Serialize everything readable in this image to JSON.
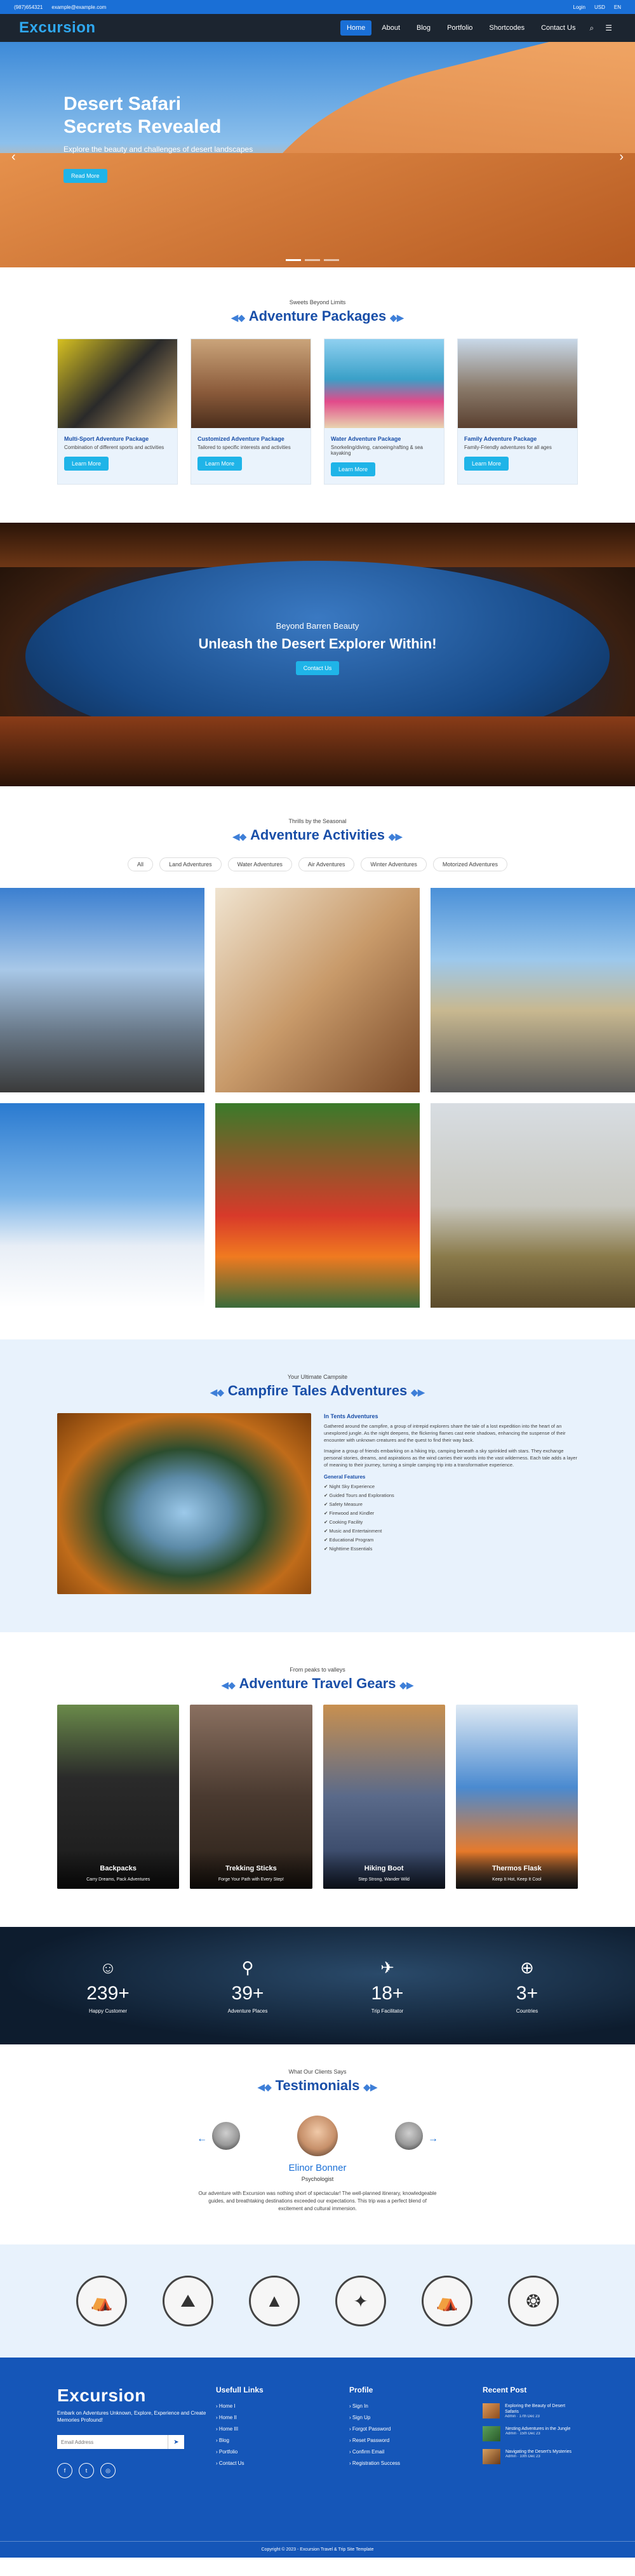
{
  "topbar": {
    "phone": "(987)654321",
    "email": "example@example.com",
    "login": "Login",
    "currency": "USD",
    "language": "EN"
  },
  "nav": {
    "logo": "Excursion",
    "items": [
      "Home",
      "About",
      "Blog",
      "Portfolio",
      "Shortcodes",
      "Contact Us"
    ],
    "active": "Home"
  },
  "hero": {
    "title": "Desert Safari Secrets Revealed",
    "subtitle": "Explore the beauty and challenges of desert landscapes",
    "button": "Read More"
  },
  "packages": {
    "subtitle": "Sweets Beyond Limits",
    "title": "Adventure Packages",
    "items": [
      {
        "title": "Multi-Sport Adventure Package",
        "desc": "Combination of different sports and activities",
        "button": "Learn More"
      },
      {
        "title": "Customized Adventure Package",
        "desc": "Tailored to specific interests and activities",
        "button": "Learn More"
      },
      {
        "title": "Water Adventure Package",
        "desc": "Snorkeling/diving, canoeing/rafting & sea kayaking",
        "button": "Learn More"
      },
      {
        "title": "Family Adventure Package",
        "desc": "Family-Friendly adventures for all ages",
        "button": "Learn More"
      }
    ]
  },
  "banner": {
    "subtitle": "Beyond Barren Beauty",
    "title": "Unleash the Desert Explorer Within!",
    "button": "Contact Us"
  },
  "activities": {
    "subtitle": "Thrills by the Seasonal",
    "title": "Adventure Activities",
    "filters": [
      "All",
      "Land Adventures",
      "Water Adventures",
      "Air Adventures",
      "Winter Adventures",
      "Motorized Adventures"
    ]
  },
  "tales": {
    "subtitle": "Your Ultimate Campsite",
    "title": "Campfire Tales Adventures",
    "heading": "In Tents Adventures",
    "p1": "Gathered around the campfire, a group of intrepid explorers share the tale of a lost expedition into the heart of an unexplored jungle. As the night deepens, the flickering flames cast eerie shadows, enhancing the suspense of their encounter with unknown creatures and the quest to find their way back.",
    "p2": "Imagine a group of friends embarking on a hiking trip, camping beneath a sky sprinkled with stars. They exchange personal stories, dreams, and aspirations as the wind carries their words into the vast wilderness. Each tale adds a layer of meaning to their journey, turning a simple camping trip into a transformative experience.",
    "features_label": "General Features",
    "features": [
      "Night Sky Experience",
      "Guided Tours and Explorations",
      "Safety Measure",
      "Firewood and Kindler",
      "Cooking Facility",
      "Music and Entertainment",
      "Educational Program",
      "Nighttime Essentials"
    ]
  },
  "gears": {
    "subtitle": "From peaks to valleys",
    "title": "Adventure Travel Gears",
    "items": [
      {
        "title": "Backpacks",
        "desc": "Carry Dreams, Pack Adventures"
      },
      {
        "title": "Trekking Sticks",
        "desc": "Forge Your Path with Every Step!"
      },
      {
        "title": "Hiking Boot",
        "desc": "Step Strong, Wander Wild"
      },
      {
        "title": "Thermos Flask",
        "desc": "Keep It Hot, Keep It Cool"
      }
    ]
  },
  "stats": [
    {
      "icon": "☺",
      "value": "239+",
      "label": "Happy Customer"
    },
    {
      "icon": "⚲",
      "value": "39+",
      "label": "Adventure Places"
    },
    {
      "icon": "✈",
      "value": "18+",
      "label": "Trip Facilitator"
    },
    {
      "icon": "⊕",
      "value": "3+",
      "label": "Countries"
    }
  ],
  "testimonials": {
    "subtitle": "What Our Clients Says",
    "title": "Testimonials",
    "name": "Elinor Bonner",
    "role": "Psychologist",
    "quote": "Our adventure with Excursion was nothing short of spectacular! The well-planned itinerary, knowledgeable guides, and breathtaking destinations exceeded our expectations. This trip was a perfect blend of excitement and cultural immersion."
  },
  "footer": {
    "logo": "Excursion",
    "about": "Embark on Adventures Unknown, Explore, Experience and Create Memories Profound!",
    "email_placeholder": "Email Address",
    "links_title": "Usefull Links",
    "links": [
      "Home I",
      "Home II",
      "Home III",
      "Blog",
      "Portfolio",
      "Contact Us"
    ],
    "profile_title": "Profile",
    "profile": [
      "Sign In",
      "Sign Up",
      "Forgot Password",
      "Reset Password",
      "Confirm Email",
      "Registration Success"
    ],
    "recent_title": "Recent Post",
    "posts": [
      {
        "title": "Exploring the Beauty of Desert Safaris",
        "date": "Admin · 17th Dec 23"
      },
      {
        "title": "Nesting Adventures in the Jungle",
        "date": "Admin · 15th Dec 23"
      },
      {
        "title": "Navigating the Desert's Mysteries",
        "date": "Admin · 10th Dec 23"
      }
    ],
    "copyright": "Copyright © 2023 - Excursion Travel & Trip Site Template"
  },
  "colors": {
    "primary": "#1a6fd6",
    "accent": "#1fb4e8",
    "navbar": "#1c2530",
    "footer": "#1556b8"
  }
}
